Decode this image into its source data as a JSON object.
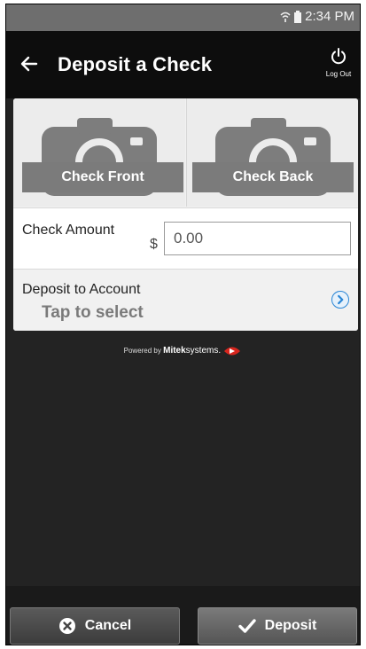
{
  "status_bar": {
    "time": "2:34 PM"
  },
  "app_bar": {
    "title": "Deposit a Check",
    "logout_label": "Log Out"
  },
  "photos": {
    "front_label": "Check Front",
    "back_label": "Check Back"
  },
  "amount": {
    "label": "Check Amount",
    "currency": "$",
    "placeholder": "0.00"
  },
  "account": {
    "label": "Deposit to Account",
    "value": "Tap to select"
  },
  "powered_by": {
    "prefix": "Powered by",
    "brand_bold": "Mitek",
    "brand_light": "systems."
  },
  "actions": {
    "cancel_label": "Cancel",
    "deposit_label": "Deposit"
  },
  "colors": {
    "accent": "#2a86d6",
    "logo_red": "#d8261e"
  }
}
